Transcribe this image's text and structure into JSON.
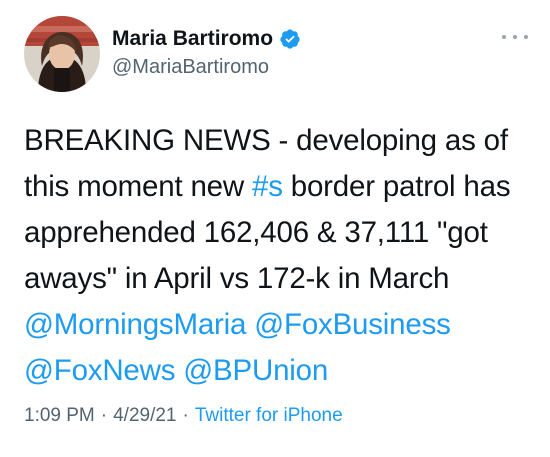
{
  "user": {
    "name": "Maria Bartiromo",
    "handle": "@MariaBartiromo"
  },
  "tweet": {
    "line1": "BREAKING NEWS - developing as of",
    "line2_pre": "this moment new ",
    "line2_hashtag": "#s",
    "line2_post": " border patrol has",
    "line3": "apprehended 162,406 & 37,111 \"got",
    "line4": "aways\" in April vs 172-k in March",
    "mention1": "@MorningsMaria",
    "mention2": "@FoxBusiness",
    "mention3": "@FoxNews",
    "mention4": "@BPUnion"
  },
  "meta": {
    "time": "1:09 PM",
    "separator": "·",
    "date": "4/29/21",
    "source": "Twitter for iPhone"
  },
  "colors": {
    "link": "#1d9bf0",
    "secondary_text": "#536471",
    "verified_badge": "#1d9bf0"
  },
  "icons": {
    "verified": "verified-badge-icon",
    "more": "more-options-icon"
  }
}
